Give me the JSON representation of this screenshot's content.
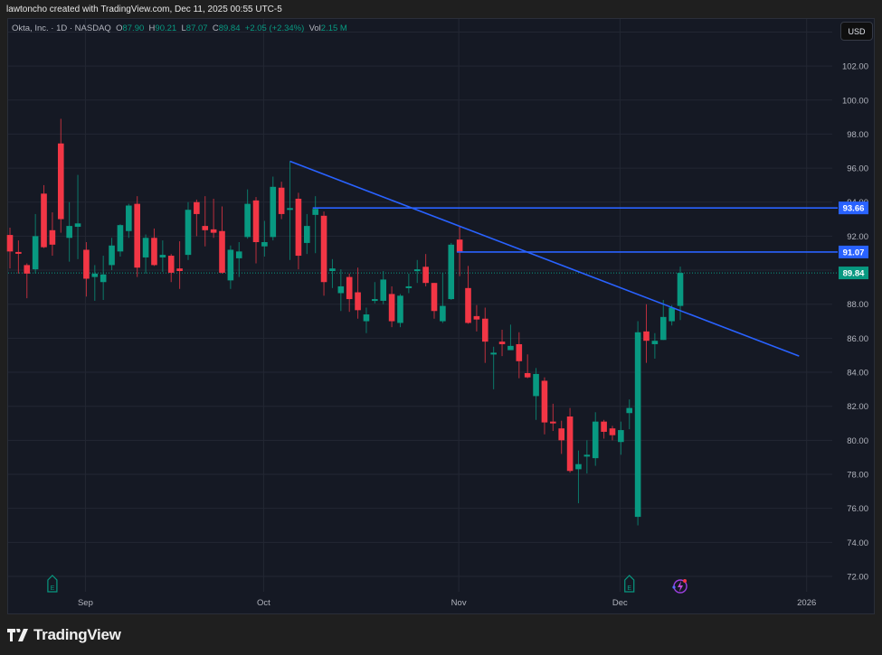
{
  "caption": "lawtoncho created with TradingView.com, Dec 11, 2025 00:55 UTC-5",
  "legend": {
    "symbol": "Okta, Inc. · 1D · NASDAQ",
    "o_label": "O",
    "o": "87.90",
    "h_label": "H",
    "h": "90.21",
    "l_label": "L",
    "l": "87.07",
    "c_label": "C",
    "c": "89.84",
    "change": "+2.05 (+2.34%)",
    "vol_label": "Vol",
    "vol": "2.15 M"
  },
  "currency_button": "USD",
  "brand": "TradingView",
  "colors": {
    "up": "#089981",
    "down": "#f23645",
    "line": "#2962ff",
    "bg": "#151924"
  },
  "chart_data": {
    "type": "candlestick",
    "title": "Okta, Inc. · 1D · NASDAQ",
    "ylim": [
      71,
      104.5
    ],
    "y_ticks": [
      "72.00",
      "74.00",
      "76.00",
      "78.00",
      "80.00",
      "82.00",
      "84.00",
      "86.00",
      "88.00",
      "90.00",
      "92.00",
      "94.00",
      "96.00",
      "98.00",
      "100.00",
      "102.00"
    ],
    "x_ticks": [
      {
        "label": "Sep",
        "index": 9
      },
      {
        "label": "Oct",
        "index": 30
      },
      {
        "label": "Nov",
        "index": 53
      },
      {
        "label": "Dec",
        "index": 72
      },
      {
        "label": "2026",
        "index": 94
      }
    ],
    "candles": [
      [
        92.07,
        92.5,
        90.1,
        91.1
      ],
      [
        91.07,
        91.75,
        89.8,
        91.05
      ],
      [
        90.3,
        90.4,
        88.35,
        89.8
      ],
      [
        90.05,
        93.3,
        89.8,
        92.0
      ],
      [
        94.5,
        95.0,
        91.3,
        91.35
      ],
      [
        92.35,
        93.4,
        90.85,
        91.5
      ],
      [
        97.45,
        98.9,
        92.2,
        93.0
      ],
      [
        91.9,
        94.0,
        90.5,
        92.6
      ],
      [
        92.55,
        95.6,
        90.65,
        92.75
      ],
      [
        91.2,
        91.65,
        88.45,
        89.5
      ],
      [
        89.6,
        90.3,
        88.2,
        89.8
      ],
      [
        89.3,
        90.85,
        88.25,
        89.75
      ],
      [
        90.3,
        91.9,
        90.0,
        91.45
      ],
      [
        91.1,
        92.7,
        90.8,
        92.65
      ],
      [
        92.3,
        93.9,
        91.9,
        93.8
      ],
      [
        93.9,
        94.35,
        89.6,
        90.15
      ],
      [
        90.75,
        92.1,
        89.8,
        91.9
      ],
      [
        91.9,
        92.45,
        90.25,
        90.3
      ],
      [
        90.75,
        91.75,
        89.9,
        90.9
      ],
      [
        90.85,
        90.95,
        89.3,
        89.85
      ],
      [
        90.1,
        91.7,
        88.9,
        89.95
      ],
      [
        90.9,
        94.0,
        90.6,
        93.55
      ],
      [
        94.0,
        94.15,
        92.0,
        93.3
      ],
      [
        92.6,
        94.35,
        91.4,
        92.35
      ],
      [
        92.4,
        94.2,
        91.9,
        92.2
      ],
      [
        92.3,
        93.75,
        89.8,
        89.85
      ],
      [
        89.4,
        91.45,
        88.9,
        91.2
      ],
      [
        90.7,
        91.65,
        89.6,
        91.1
      ],
      [
        91.95,
        94.75,
        91.85,
        93.9
      ],
      [
        94.1,
        94.3,
        90.4,
        91.65
      ],
      [
        91.4,
        92.9,
        90.8,
        91.65
      ],
      [
        91.95,
        95.5,
        91.75,
        94.9
      ],
      [
        94.85,
        95.2,
        93.0,
        93.3
      ],
      [
        93.6,
        96.4,
        90.6,
        93.65
      ],
      [
        94.2,
        94.55,
        90.05,
        90.85
      ],
      [
        91.6,
        93.3,
        90.95,
        92.6
      ],
      [
        93.25,
        94.35,
        91.0,
        93.6
      ],
      [
        93.2,
        93.45,
        88.5,
        89.3
      ],
      [
        89.95,
        90.65,
        88.95,
        90.1
      ],
      [
        88.65,
        90.05,
        87.6,
        89.05
      ],
      [
        89.6,
        89.8,
        87.55,
        88.3
      ],
      [
        88.7,
        90.15,
        87.15,
        87.65
      ],
      [
        87.0,
        87.8,
        86.3,
        87.4
      ],
      [
        88.25,
        89.3,
        88.05,
        88.3
      ],
      [
        88.2,
        89.95,
        88.0,
        89.45
      ],
      [
        88.6,
        89.05,
        86.65,
        87.0
      ],
      [
        86.9,
        88.6,
        86.65,
        88.5
      ],
      [
        88.95,
        89.8,
        88.65,
        89.05
      ],
      [
        90.0,
        90.6,
        89.25,
        90.05
      ],
      [
        90.2,
        90.95,
        89.05,
        89.25
      ],
      [
        89.25,
        89.25,
        87.15,
        87.6
      ],
      [
        87.0,
        89.85,
        86.9,
        87.9
      ],
      [
        88.3,
        91.6,
        88.25,
        91.5
      ],
      [
        91.8,
        92.55,
        89.65,
        91.05
      ],
      [
        88.95,
        90.25,
        86.85,
        86.9
      ],
      [
        87.3,
        87.95,
        86.4,
        87.1
      ],
      [
        87.15,
        87.8,
        84.55,
        85.8
      ],
      [
        85.1,
        85.5,
        83.0,
        85.15
      ],
      [
        85.8,
        86.5,
        84.95,
        85.65
      ],
      [
        85.3,
        86.8,
        85.3,
        85.55
      ],
      [
        85.65,
        86.35,
        83.65,
        84.65
      ],
      [
        83.95,
        85.05,
        83.65,
        83.7
      ],
      [
        82.6,
        84.25,
        81.2,
        83.9
      ],
      [
        83.5,
        83.7,
        80.35,
        81.05
      ],
      [
        81.1,
        82.15,
        80.55,
        81.0
      ],
      [
        80.7,
        81.15,
        79.2,
        80.0
      ],
      [
        81.4,
        81.9,
        78.1,
        78.2
      ],
      [
        78.3,
        79.4,
        76.3,
        78.6
      ],
      [
        79.1,
        80.0,
        78.05,
        79.15
      ],
      [
        78.95,
        81.65,
        78.5,
        81.1
      ],
      [
        81.1,
        81.2,
        80.1,
        80.5
      ],
      [
        80.7,
        80.85,
        80.0,
        80.3
      ],
      [
        79.9,
        81.1,
        79.15,
        80.6
      ],
      [
        81.6,
        82.4,
        80.65,
        81.9
      ],
      [
        75.5,
        87.0,
        75.0,
        86.35
      ],
      [
        86.4,
        88.0,
        84.55,
        85.85
      ],
      [
        85.65,
        86.3,
        84.8,
        85.85
      ],
      [
        85.9,
        88.25,
        85.9,
        87.25
      ],
      [
        87.0,
        87.95,
        86.75,
        87.8
      ],
      [
        87.9,
        90.21,
        87.07,
        89.84
      ]
    ],
    "horizontal_lines": [
      {
        "price": 93.66,
        "label": "93.66",
        "start_index": 36
      },
      {
        "price": 91.07,
        "label": "91.07",
        "start_index": 53
      }
    ],
    "trendline": {
      "from": {
        "index": 33,
        "price": 96.4
      },
      "to": {
        "index": 93,
        "price": 84.95
      }
    },
    "last_price": {
      "price": 89.84,
      "label": "89.84"
    },
    "events": [
      {
        "type": "earnings",
        "index": 5,
        "label": "E"
      },
      {
        "type": "earnings",
        "index": 73,
        "label": "E"
      },
      {
        "type": "dividend-split",
        "index": 79
      }
    ]
  }
}
